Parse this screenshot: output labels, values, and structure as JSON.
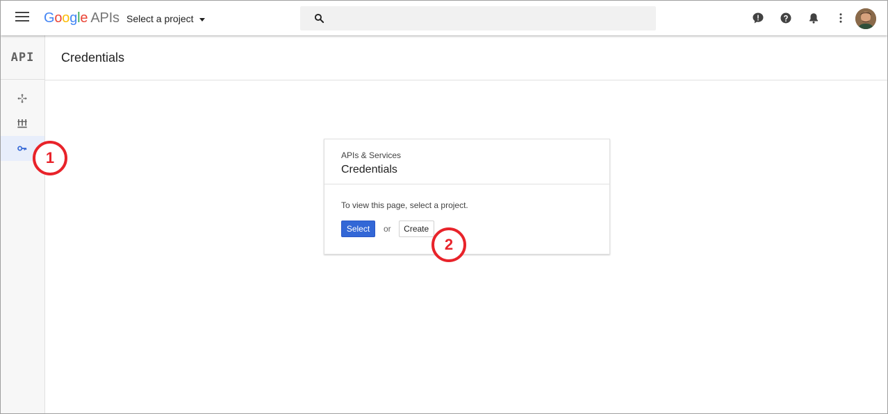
{
  "topbar": {
    "logo_letters": [
      "G",
      "o",
      "o",
      "g",
      "l",
      "e"
    ],
    "logo_suffix": "APIs",
    "project_select_label": "Select a project",
    "search_placeholder": "",
    "icons": [
      "menu-icon",
      "search-icon",
      "feedback-icon",
      "help-icon",
      "notifications-icon",
      "more-vert-icon"
    ]
  },
  "rail": {
    "logo_text": "API",
    "items": [
      {
        "name": "dashboard",
        "icon": "move-icon"
      },
      {
        "name": "library",
        "icon": "library-icon"
      },
      {
        "name": "credentials",
        "icon": "key-icon",
        "active": true
      }
    ]
  },
  "header": {
    "title": "Credentials"
  },
  "card": {
    "subtitle": "APIs & Services",
    "title": "Credentials",
    "message": "To view this page, select a project.",
    "select_label": "Select",
    "or_text": "or",
    "create_label": "Create"
  },
  "callouts": [
    "1",
    "2"
  ],
  "colors": {
    "primary": "#3367d6",
    "callout": "#e8232a",
    "rail_active": "#e8eefb"
  }
}
